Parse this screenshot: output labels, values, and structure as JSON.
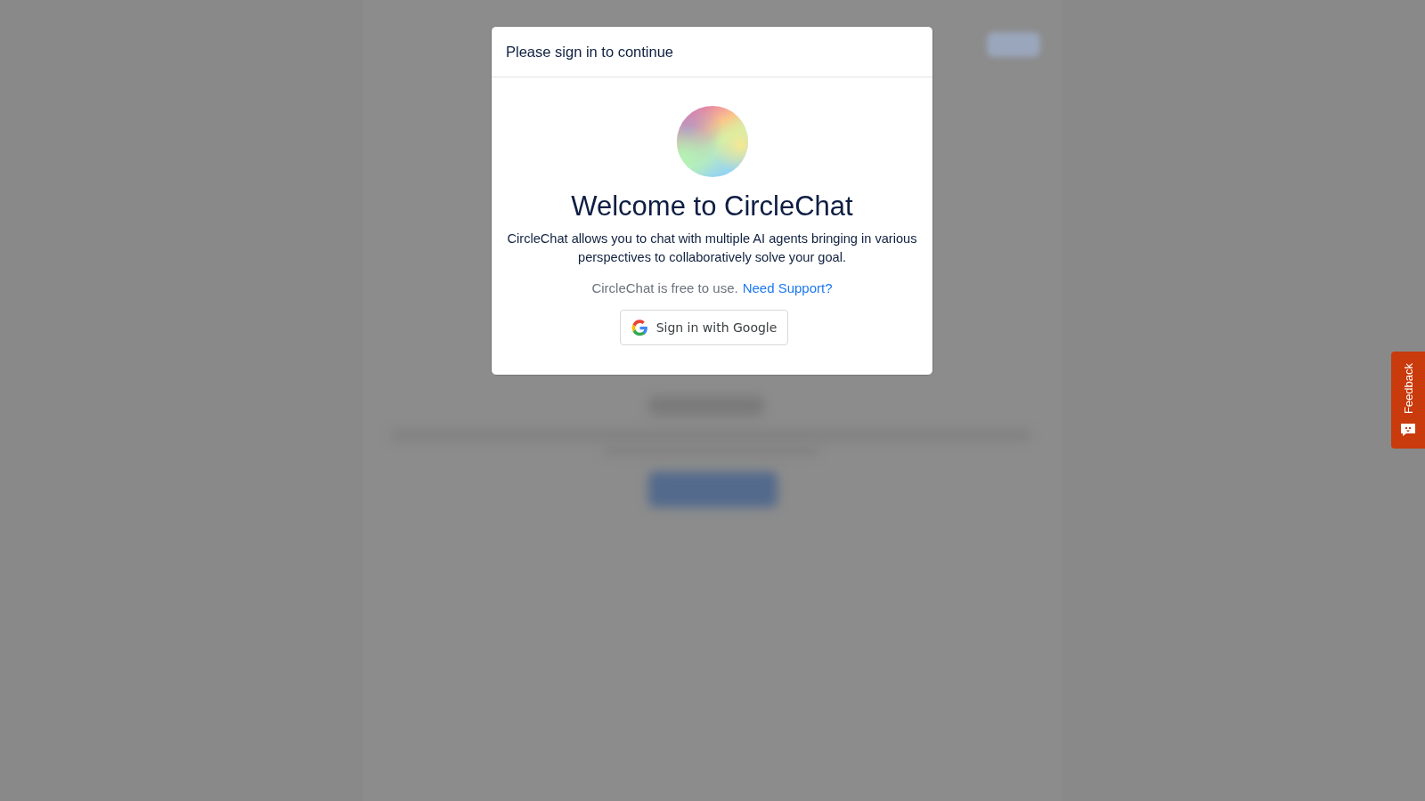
{
  "dialog": {
    "title": "Please sign in to continue",
    "heading": "Welcome to CircleChat",
    "description": "CircleChat allows you to chat with multiple AI agents bringing in various perspectives to collaboratively solve your goal.",
    "note": "CircleChat is free to use.",
    "support_link": "Need Support?",
    "sign_in_button": "Sign in with Google"
  },
  "feedback_tab": {
    "label": "Feedback"
  }
}
